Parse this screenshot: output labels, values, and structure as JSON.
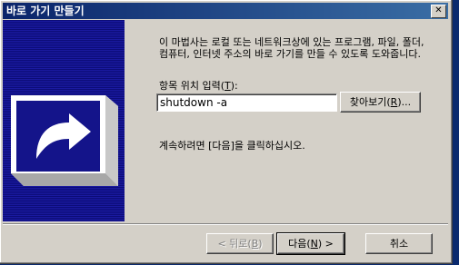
{
  "window": {
    "title": "바로 가기 만들기",
    "close_symbol": "✕"
  },
  "intro_text": "이 마법사는 로컬 또는 네트워크상에 있는 프로그램, 파일, 폴더, 컴퓨터, 인터넷 주소의 바로 가기를 만들 수 있도록 도와줍니다.",
  "field": {
    "label_prefix": "항목 위치 입력(",
    "label_hotkey": "T",
    "label_suffix": "):",
    "value": "shutdown -a"
  },
  "browse": {
    "prefix": "찾아보기(",
    "hotkey": "R",
    "suffix": ")..."
  },
  "continue_text": "계속하려면 [다음]을 클릭하십시오.",
  "buttons": {
    "back": {
      "prefix": "< 뒤로(",
      "hotkey": "B",
      "suffix": ")"
    },
    "next": {
      "prefix": "다음(",
      "hotkey": "N",
      "suffix": ") >"
    },
    "cancel": "취소"
  },
  "colors": {
    "title_start": "#0a246a",
    "title_end": "#3a6ea5",
    "panel": "#14148a",
    "face": "#d4d0c8"
  },
  "icons": {
    "wizard_art": "shortcut-arrow-icon",
    "close": "close-icon"
  }
}
